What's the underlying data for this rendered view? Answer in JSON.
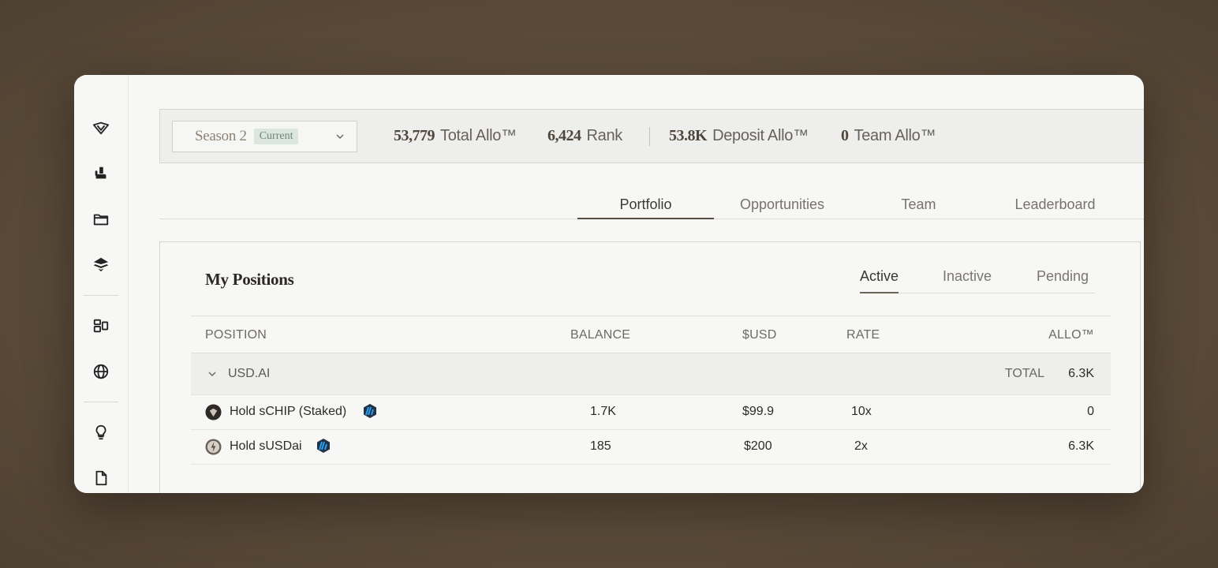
{
  "sidebar": {
    "icons": [
      "logo-icon",
      "seat-icon",
      "folder-icon",
      "stack-icon",
      "dashboard-icon",
      "globe-icon",
      "lightbulb-icon",
      "document-icon"
    ]
  },
  "stats": {
    "season": "Season 2",
    "season_badge": "Current",
    "total_allo_value": "53,779",
    "total_allo_label": "Total Allo™",
    "rank_value": "6,424",
    "rank_label": "Rank",
    "deposit_allo_value": "53.8K",
    "deposit_allo_label": "Deposit Allo™",
    "team_allo_value": "0",
    "team_allo_label": "Team Allo™"
  },
  "tabs": {
    "portfolio": "Portfolio",
    "opportunities": "Opportunities",
    "team": "Team",
    "leaderboard": "Leaderboard"
  },
  "positions": {
    "title": "My Positions",
    "subtabs": {
      "active": "Active",
      "inactive": "Inactive",
      "pending": "Pending"
    },
    "columns": {
      "position": "POSITION",
      "balance": "BALANCE",
      "usd": "$USD",
      "rate": "RATE",
      "allo": "ALLO™"
    },
    "group": {
      "name": "USD.AI",
      "total_label": "TOTAL",
      "total_value": "6.3K"
    },
    "rows": [
      {
        "name": "Hold sCHIP (Staked)",
        "balance": "1.7K",
        "usd": "$99.9",
        "rate": "10x",
        "allo": "0"
      },
      {
        "name": "Hold sUSDai",
        "balance": "185",
        "usd": "$200",
        "rate": "2x",
        "allo": "6.3K"
      }
    ]
  },
  "colors": {
    "background": "#5e4e3d",
    "window": "#f7f7f6",
    "accent": "#574c41",
    "badge": "#dbe6e0"
  }
}
